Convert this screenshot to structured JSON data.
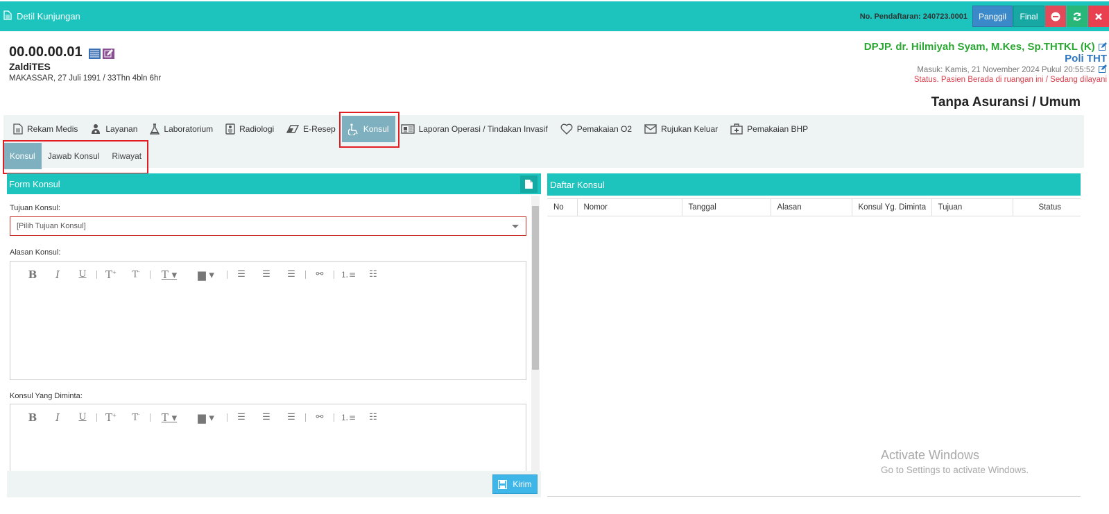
{
  "header": {
    "title": "Detil Kunjungan",
    "registration": "No. Pendaftaran: 240723.0001",
    "buttons": {
      "panggil": "Panggil",
      "final": "Final"
    }
  },
  "patient": {
    "record_no": "00.00.00.01",
    "name": "ZaldiTES",
    "birth_info": "MAKASSAR, 27 Juli 1991 / 33Thn 4bln 6hr"
  },
  "visit": {
    "dpjp": "DPJP. dr. Hilmiyah Syam, M.Kes, Sp.THTKL (K)",
    "poli": "Poli THT",
    "masuk": "Masuk: Kamis, 21 November 2024 Pukul 20:55:52",
    "status": "Status. Pasien Berada di ruangan ini / Sedang dilayani",
    "insurance": "Tanpa Asuransi / Umum"
  },
  "nav": {
    "items": [
      {
        "label": "Rekam Medis",
        "icon": "document-icon"
      },
      {
        "label": "Layanan",
        "icon": "doctor-icon"
      },
      {
        "label": "Laboratorium",
        "icon": "flask-icon"
      },
      {
        "label": "Radiologi",
        "icon": "xray-icon"
      },
      {
        "label": "E-Resep",
        "icon": "eraser-icon"
      },
      {
        "label": "Konsul",
        "icon": "wheelchair-icon"
      },
      {
        "label": "Laporan Operasi / Tindakan Invasif",
        "icon": "newspaper-icon"
      },
      {
        "label": "Pemakaian O2",
        "icon": "heart-icon"
      },
      {
        "label": "Rujukan Keluar",
        "icon": "envelope-icon"
      },
      {
        "label": "Pemakaian BHP",
        "icon": "medkit-icon"
      }
    ],
    "active": "Konsul"
  },
  "subnav": {
    "items": [
      {
        "label": "Konsul"
      },
      {
        "label": "Jawab Konsul"
      },
      {
        "label": "Riwayat"
      }
    ],
    "active": "Konsul"
  },
  "form": {
    "title": "Form Konsul",
    "tujuan_label": "Tujuan Konsul:",
    "tujuan_value": "[Pilih Tujuan Konsul]",
    "alasan_label": "Alasan Konsul:",
    "diminta_label": "Konsul Yang Diminta:",
    "submit_label": "Kirim"
  },
  "list": {
    "title": "Daftar Konsul",
    "columns": [
      "No",
      "Nomor",
      "Tanggal",
      "Alasan",
      "Konsul Yg. Diminta",
      "Tujuan",
      "Status"
    ],
    "rows": []
  },
  "watermark": {
    "line1": "Activate Windows",
    "line2": "Go to Settings to activate Windows."
  },
  "colors": {
    "teal": "#1cc4bd",
    "active_tab": "#7fb0bf",
    "dpjp_green": "#2aa732",
    "poli_blue": "#2f76c0",
    "status_red": "#d9434f",
    "highlight_red": "#e31d24"
  }
}
